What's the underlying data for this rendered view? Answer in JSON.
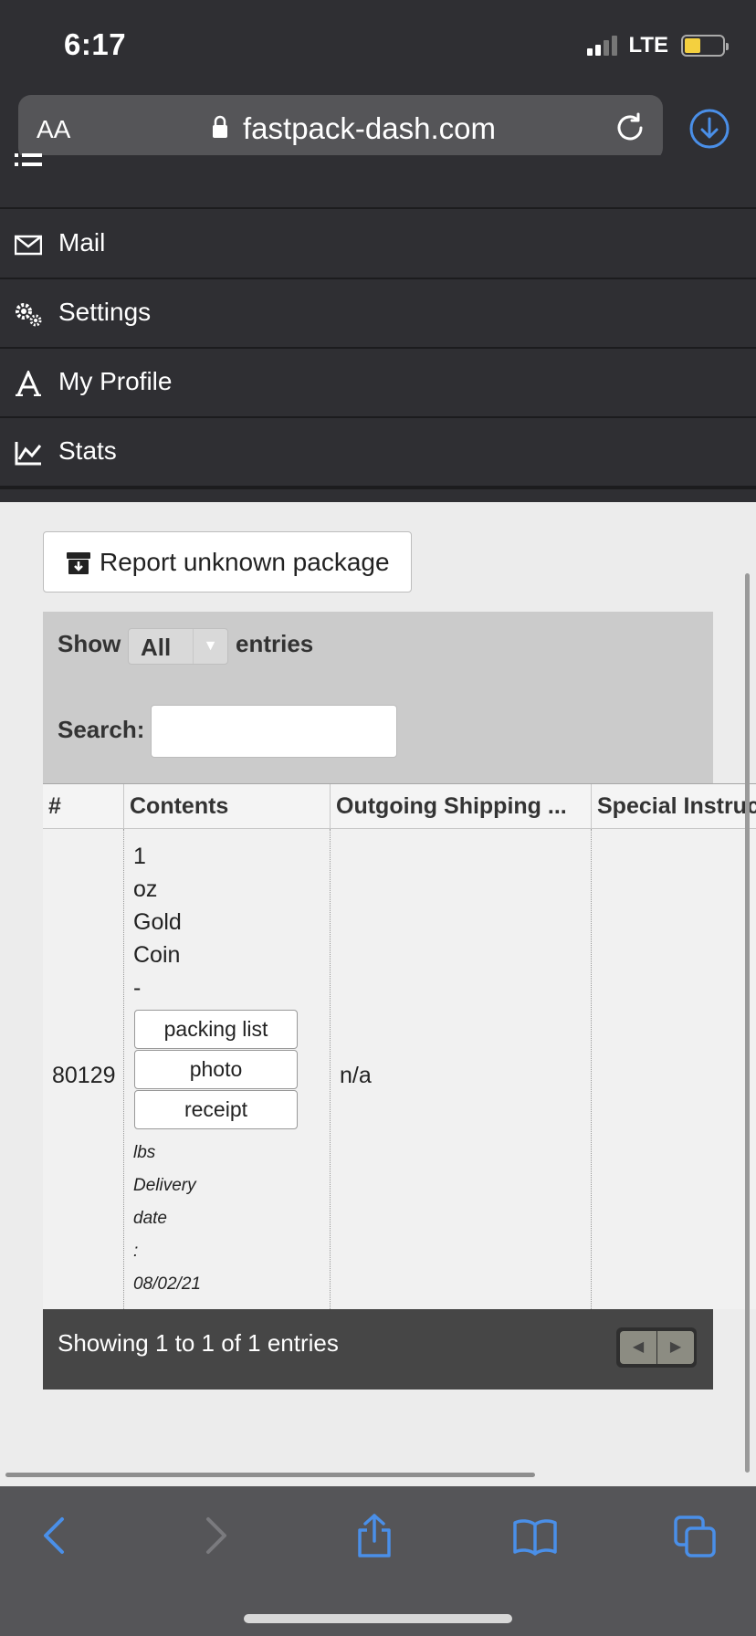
{
  "status_bar": {
    "time": "6:17",
    "network": "LTE"
  },
  "browser": {
    "text_size_label": "AA",
    "url": "fastpack-dash.com",
    "accent_color": "#4a8fe8"
  },
  "menu": {
    "items": [
      {
        "label": "Mail",
        "icon": "mail-icon"
      },
      {
        "label": "Settings",
        "icon": "gears-icon"
      },
      {
        "label": "My Profile",
        "icon": "letter-a-icon"
      },
      {
        "label": "Stats",
        "icon": "line-chart-icon"
      }
    ]
  },
  "content": {
    "report_button": "Report unknown package",
    "show_label": "Show",
    "show_value": "All",
    "entries_label": "entries",
    "search_label": "Search:",
    "search_value": "",
    "table": {
      "headers": [
        "#",
        "Contents",
        "Outgoing Shipping ...",
        "Special Instruc"
      ],
      "row": {
        "id": "80129",
        "contents_lines": [
          "1",
          "oz",
          "Gold",
          "Coin",
          "-"
        ],
        "buttons": [
          "packing list",
          "photo",
          "receipt"
        ],
        "details_lines": [
          "lbs",
          "Delivery",
          "date",
          ":",
          "08/02/21"
        ],
        "outgoing_shipping": "n/a",
        "special_instructions": ""
      }
    },
    "info": "Showing 1 to 1 of 1 entries"
  }
}
